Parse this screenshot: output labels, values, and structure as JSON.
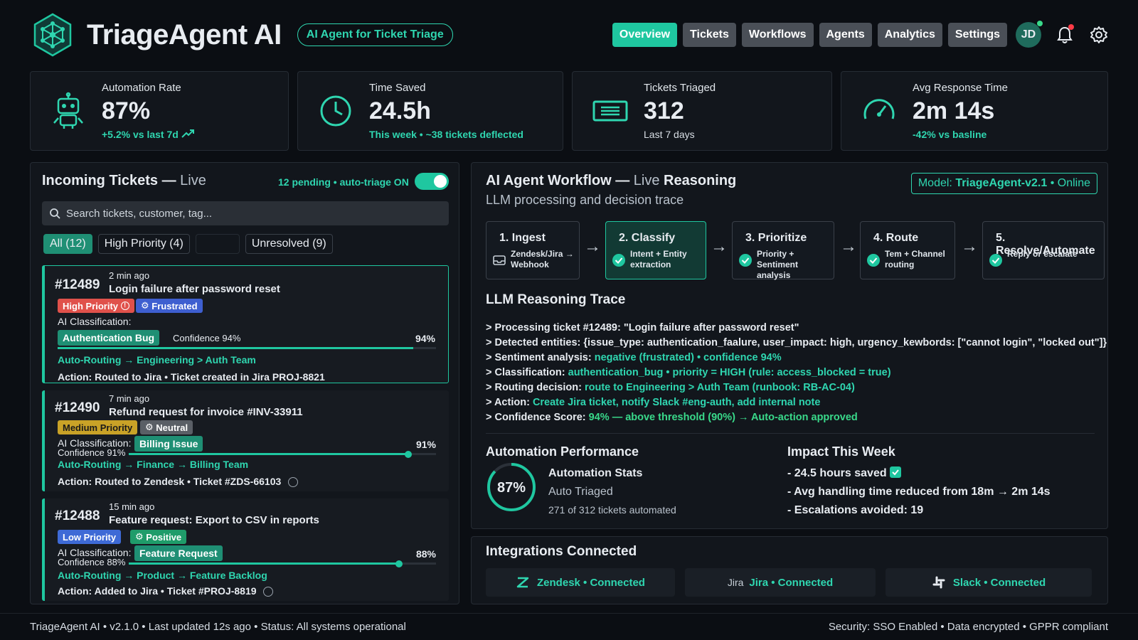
{
  "header": {
    "app_title": "TriageAgent AI",
    "tagline": "AI Agent for Ticket Triage",
    "nav": [
      "Overview",
      "Tickets",
      "Workflows",
      "Agents",
      "Analytics",
      "Settings"
    ],
    "active_nav": "Overview",
    "avatar_initials": "JD"
  },
  "kpis": [
    {
      "label": "Automation Rate",
      "value": "87%",
      "sub": "+5.2% vs last 7d",
      "icon": "robot-icon"
    },
    {
      "label": "Time Saved",
      "value": "24.5h",
      "sub": "This week • ~38 tickets deflected",
      "icon": "clock-icon"
    },
    {
      "label": "Tickets Triaged",
      "value": "312",
      "sub": "Last 7 days",
      "icon": "ticket-icon"
    },
    {
      "label": "Avg Response Time",
      "value": "2m 14s",
      "sub": "-42% vs basline",
      "icon": "speedometer-icon"
    }
  ],
  "incoming": {
    "title_main": "Incoming Tickets — ",
    "title_live": "Live",
    "status": "12 pending • auto-triage ON",
    "search_placeholder": "Search tickets, customer, tag...",
    "filters": [
      "All (12)",
      "High Priority (4)",
      "",
      "Unresolved (9)"
    ],
    "tickets": [
      {
        "id": "#12489",
        "ago": "2 min ago",
        "title": "Login failure after password reset",
        "priority": "High Priority",
        "sentiment": "Frustrated",
        "ai_label": "AI Classification:",
        "category": "Authentication Bug",
        "confidence_text": "Confidence 94%",
        "confidence": 94,
        "confidence_pct": "94%",
        "routing": "Auto-Routing → Engineering > Auth Team",
        "action": "Action: Routed to Jira • Ticket created in Jira PROJ-8821"
      },
      {
        "id": "#12490",
        "ago": "7 min ago",
        "title": "Refund request for invoice #INV-33911",
        "priority": "Medium Priority",
        "sentiment": "Neutral",
        "ai_label": "AI Classification:",
        "category": "Billing Issue",
        "confidence_text": "Confidence 91%",
        "confidence": 91,
        "confidence_pct": "91%",
        "routing": "Auto-Routing → Finance → Billing Team",
        "action": "Action: Routed to Zendesk • Ticket #ZDS-66103"
      },
      {
        "id": "#12488",
        "ago": "15 min ago",
        "title": "Feature request: Export to CSV in reports",
        "priority": "Low Priority",
        "sentiment": "Positive",
        "ai_label": "AI Classification:",
        "category": "Feature Request",
        "confidence_text": "Confidence 88%",
        "confidence": 88,
        "confidence_pct": "88%",
        "routing": "Auto-Routing → Product → Feature Backlog",
        "action": "Action: Added to Jira • Ticket #PROJ-8819"
      }
    ]
  },
  "workflow": {
    "title_main": "AI Agent Workflow — ",
    "title_live": "Live",
    "title_end": " Reasoning",
    "subtitle": "LLM processing and decision trace",
    "model_prefix": "Model: ",
    "model_name": "TriageAgent-v2.1",
    "model_status": " • Online",
    "steps": [
      {
        "name": "1. Ingest",
        "desc1": "Zendesk/Jira →",
        "desc2": "Webhook"
      },
      {
        "name": "2. Classify",
        "desc1": "Intent + Entity",
        "desc2": "extraction"
      },
      {
        "name": "3. Prioritize",
        "desc1": "Priority + Sentiment",
        "desc2": "analysis"
      },
      {
        "name": "4. Route",
        "desc1": "Tem + Channel",
        "desc2": "routing"
      },
      {
        "name": "5. Resolve/Automate",
        "desc1": "Reply or escalate",
        "desc2": ""
      }
    ],
    "trace_title": "LLM Reasoning Trace",
    "trace": [
      {
        "k": "> Processing ticket ",
        "v": "#12489",
        "r": ": \"Login failure after password reset\""
      },
      {
        "k": "> Detected entities: ",
        "v": "{issue_type: authentication_faalure, user_impact: high, urgency_kewbords: [\"cannot login\", \"locked out\"]}",
        "r": ""
      },
      {
        "k": "> Sentiment analysis: ",
        "v": "negative (frustrated) • confidence 94%",
        "r": ""
      },
      {
        "k": "> Classification: ",
        "v": "authentication_bug • priority = HIGH (rule: access_blocked = true)",
        "r": ""
      },
      {
        "k": "> Routing decision: ",
        "v": "route to Engineering > Auth Team (runbook: RB-AC-04)",
        "r": ""
      },
      {
        "k": "> Action: ",
        "v": "Create Jira ticket, notify Slack #eng-auth, add internal note",
        "r": ""
      },
      {
        "k": "> Confidence Score: ",
        "v": "94% — above threshold (90%) → Auto-action approved",
        "r": ""
      }
    ],
    "perf_title": "Automation Performance",
    "perf_value": "87%",
    "perf_fraction": 0.87,
    "stats_title": "Automation Stats",
    "stats_sub": "Auto Triaged",
    "stats_detail": "271 of 312 tickets automated",
    "impact_title": "Impact This Week",
    "impact": [
      "- 24.5 hours saved",
      "- Avg handling time reduced from 18m → 2m 14s",
      "- Escalations avoided: 19"
    ]
  },
  "integrations": {
    "title": "Integrations Connected",
    "items": [
      {
        "name": "Zendesk • Connected",
        "icon": "zendesk-icon"
      },
      {
        "name": "Jira • Connected",
        "icon": "jira-icon",
        "glyph": "Jira"
      },
      {
        "name": "Slack • Connected",
        "icon": "slack-icon"
      }
    ]
  },
  "footer": {
    "left": "TriageAgent AI • v2.1.0 • Last updated 12s ago • Status: All systems operational",
    "right": "Security: SSO Enabled • Data encrypted • GPPR compliant"
  },
  "colors": {
    "accent": "#1fc7a0",
    "high": "#e0514b",
    "medium": "#c9a227",
    "low": "#3e6ad6",
    "positive": "#1f9c6a"
  }
}
